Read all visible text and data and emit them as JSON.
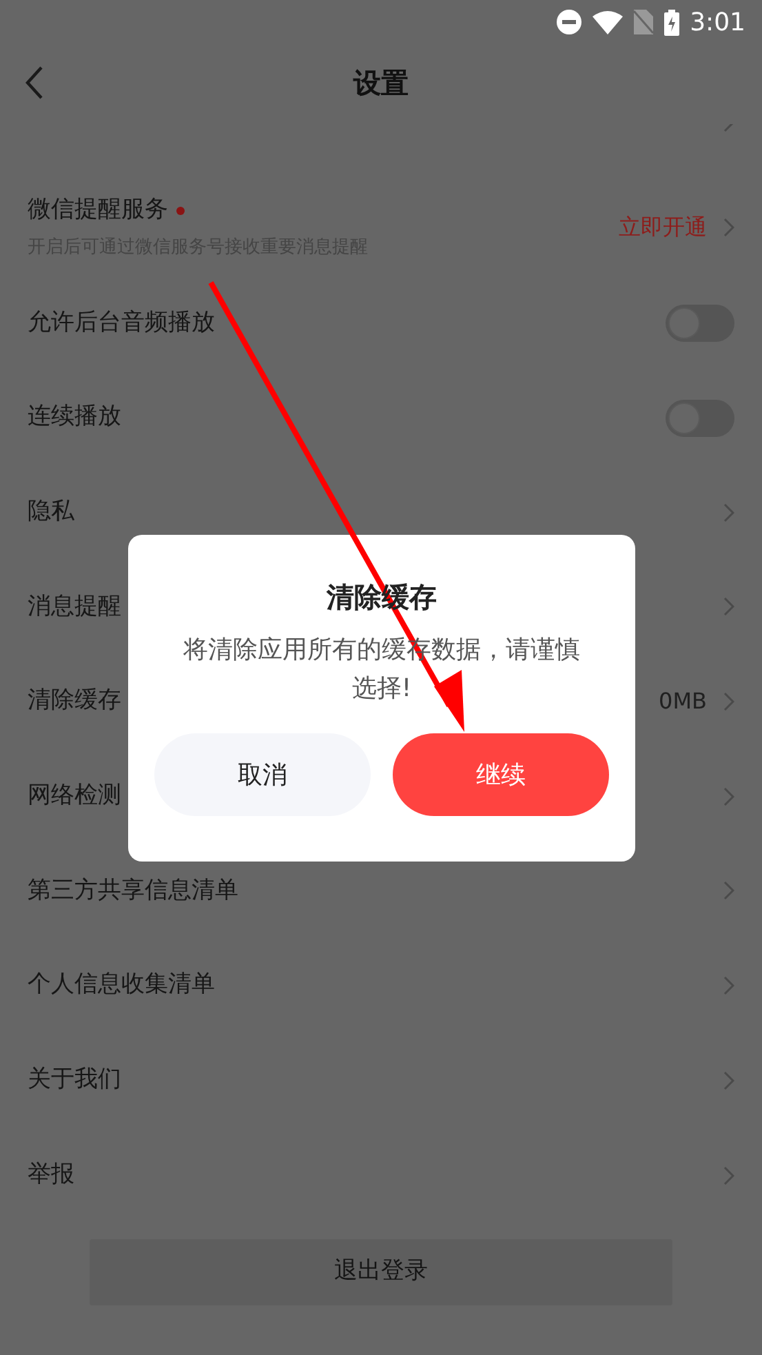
{
  "status_bar": {
    "time": "3:01"
  },
  "header": {
    "title": "设置"
  },
  "settings": [
    {
      "kind": "cut"
    },
    {
      "kind": "link",
      "label": "微信提醒服务",
      "new_dot": true,
      "subtitle": "开启后可通过微信服务号接收重要消息提醒",
      "value": {
        "text": "立即开通",
        "kind": "accent"
      }
    },
    {
      "kind": "toggle",
      "label": "允许后台音频播放",
      "on": false
    },
    {
      "kind": "toggle",
      "label": "连续播放",
      "on": false
    },
    {
      "kind": "link",
      "label": "隐私"
    },
    {
      "kind": "link",
      "label": "消息提醒"
    },
    {
      "kind": "link",
      "label": "清除缓存",
      "value": {
        "text": "0MB",
        "kind": "plain"
      }
    },
    {
      "kind": "link",
      "label": "网络检测"
    },
    {
      "kind": "link",
      "label": "第三方共享信息清单"
    },
    {
      "kind": "link",
      "label": "个人信息收集清单"
    },
    {
      "kind": "link",
      "label": "关于我们"
    },
    {
      "kind": "link",
      "label": "举报"
    }
  ],
  "logout": {
    "label": "退出登录"
  },
  "dialog": {
    "title": "清除缓存",
    "message": "将清除应用所有的缓存数据，请谨慎选择!",
    "buttons": [
      {
        "label": "取消",
        "kind": "secondary"
      },
      {
        "label": "继续",
        "kind": "primary"
      }
    ]
  }
}
